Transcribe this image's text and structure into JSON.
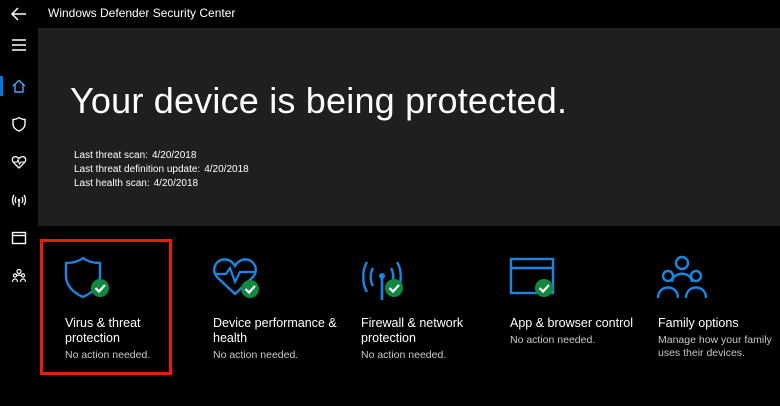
{
  "window": {
    "title": "Windows Defender Security Center"
  },
  "sidebar": {
    "items": [
      {
        "icon": "hamburger-menu-icon"
      },
      {
        "icon": "home-icon",
        "active": true
      },
      {
        "icon": "shield-icon"
      },
      {
        "icon": "heart-pulse-icon"
      },
      {
        "icon": "wireless-icon"
      },
      {
        "icon": "browser-window-icon"
      },
      {
        "icon": "family-icon"
      }
    ]
  },
  "hero": {
    "title": "Your device is being protected.",
    "scans": [
      {
        "label": "Last threat scan:",
        "value": "4/20/2018"
      },
      {
        "label": "Last threat definition update:",
        "value": "4/20/2018"
      },
      {
        "label": "Last health scan:",
        "value": "4/20/2018"
      }
    ]
  },
  "tiles": [
    {
      "title": "Virus & threat protection",
      "subtitle": "No action needed.",
      "icon": "shield-check-icon",
      "highlighted": true
    },
    {
      "title": "Device performance & health",
      "subtitle": "No action needed.",
      "icon": "heart-pulse-check-icon"
    },
    {
      "title": "Firewall & network protection",
      "subtitle": "No action needed.",
      "icon": "wireless-tower-check-icon"
    },
    {
      "title": "App & browser control",
      "subtitle": "No action needed.",
      "icon": "browser-window-check-icon"
    },
    {
      "title": "Family options",
      "subtitle": "Manage how your family uses their devices.",
      "icon": "family-icon"
    }
  ],
  "colors": {
    "accent": "#0078d7",
    "ok": "#10893e",
    "highlight": "#e81c0b"
  }
}
